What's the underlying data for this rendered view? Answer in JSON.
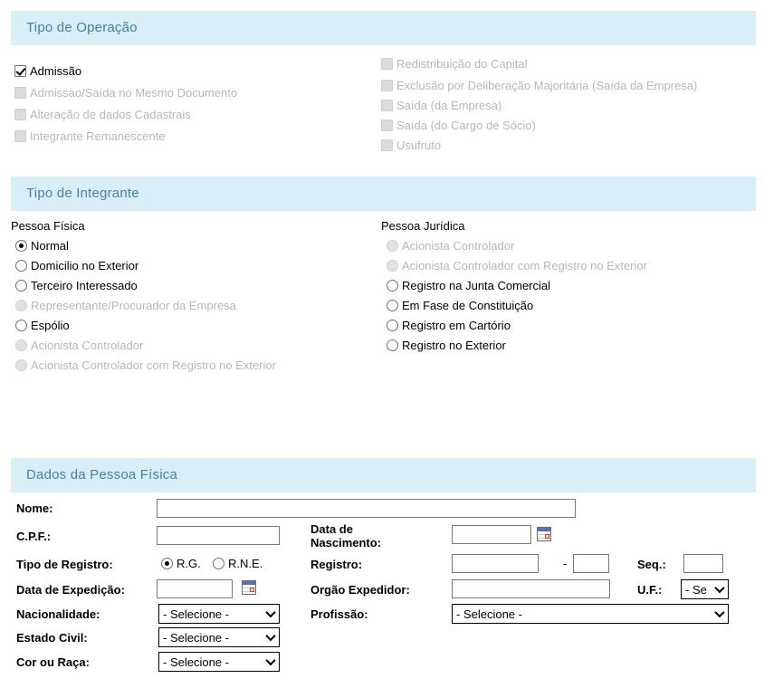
{
  "sections": {
    "operacao": {
      "title": "Tipo de Operação",
      "left_options": [
        {
          "label": "Admissão",
          "checked": true,
          "disabled": false
        },
        {
          "label": "Admissao/Saída no Mesmo Documento",
          "checked": false,
          "disabled": true
        },
        {
          "label": "Alteração de dados Cadastrais",
          "checked": false,
          "disabled": true
        },
        {
          "label": "Integrante Remanescente",
          "checked": false,
          "disabled": true
        }
      ],
      "right_options": [
        {
          "label": "Redistribuição do Capital",
          "checked": false,
          "disabled": true
        },
        {
          "label": "Exclusão por Deliberação Majoritária (Saída da Empresa)",
          "checked": false,
          "disabled": true
        },
        {
          "label": "Saída (da Empresa)",
          "checked": false,
          "disabled": true
        },
        {
          "label": "Saída (do Cargo de Sócio)",
          "checked": false,
          "disabled": true
        },
        {
          "label": "Usufruto",
          "checked": false,
          "disabled": true
        }
      ]
    },
    "integrante": {
      "title": "Tipo de Integrante",
      "pessoa_fisica_heading": "Pessoa Física",
      "pessoa_juridica_heading": "Pessoa Jurídica",
      "pessoa_fisica_options": [
        {
          "label": "Normal",
          "selected": true,
          "disabled": false
        },
        {
          "label": "Domicilio no Exterior",
          "selected": false,
          "disabled": false
        },
        {
          "label": "Terceiro Interessado",
          "selected": false,
          "disabled": false
        },
        {
          "label": "Representante/Procurador da Empresa",
          "selected": false,
          "disabled": true
        },
        {
          "label": "Espólio",
          "selected": false,
          "disabled": false
        },
        {
          "label": "Acionista Controlador",
          "selected": false,
          "disabled": true
        },
        {
          "label": "Acionista Controlador com Registro no Exterior",
          "selected": false,
          "disabled": true
        }
      ],
      "pessoa_juridica_options": [
        {
          "label": "Acionista Controlador",
          "selected": false,
          "disabled": true
        },
        {
          "label": "Acionista Controlador com Registro no Exterior",
          "selected": false,
          "disabled": true
        },
        {
          "label": "Registro na Junta Comercial",
          "selected": false,
          "disabled": false
        },
        {
          "label": "Em Fase de Constituição",
          "selected": false,
          "disabled": false
        },
        {
          "label": "Registro em Cartório",
          "selected": false,
          "disabled": false
        },
        {
          "label": "Registro no Exterior",
          "selected": false,
          "disabled": false
        }
      ]
    },
    "dados": {
      "title": "Dados da Pessoa Física",
      "labels": {
        "nome": "Nome:",
        "cpf": "C.P.F.:",
        "data_nascimento_l1": "Data de",
        "data_nascimento_l2": "Nascimento:",
        "tipo_registro": "Tipo de Registro:",
        "registro": "Registro:",
        "seq": "Seq.:",
        "data_expedicao": "Data de Expedição:",
        "orgao_expedidor": "Orgão Expedidor:",
        "uf": "U.F.:",
        "nacionalidade": "Nacionalidade:",
        "profissao": "Profissão:",
        "estado_civil": "Estado Civil:",
        "cor_raca": "Cor ou Raça:"
      },
      "values": {
        "nome": "",
        "cpf": "",
        "data_nascimento": "",
        "registro_num": "",
        "registro_dig": "",
        "seq": "",
        "data_expedicao": "",
        "orgao_expedidor": "",
        "uf": "- Se",
        "nacionalidade": "- Selecione -",
        "profissao": "- Selecione -",
        "estado_civil": "- Selecione -",
        "cor_raca": "- Selecione -"
      },
      "tipo_registro_options": [
        {
          "label": "R.G.",
          "selected": true
        },
        {
          "label": "R.N.E.",
          "selected": false
        }
      ],
      "separators": {
        "registro_dash": "-"
      }
    }
  },
  "colors": {
    "section_bar_bg": "#d9eef7",
    "section_title": "#4a7fa5",
    "disabled_text": "#b7b7b7",
    "page_bg": "#ffffff"
  }
}
